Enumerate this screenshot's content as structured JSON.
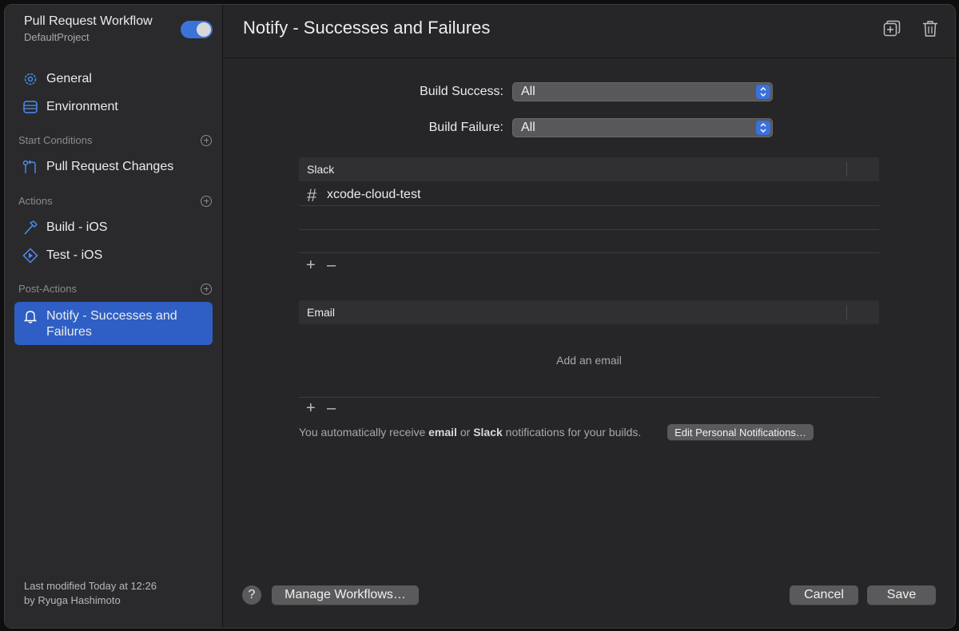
{
  "sidebar": {
    "workflow_title": "Pull Request Workflow",
    "workflow_project": "DefaultProject",
    "toggle_on": true,
    "items": [
      {
        "label": "General",
        "icon": "gear-icon"
      },
      {
        "label": "Environment",
        "icon": "environment-icon"
      }
    ],
    "start_conditions": {
      "heading": "Start Conditions",
      "items": [
        {
          "label": "Pull Request Changes",
          "icon": "pull-request-icon"
        }
      ]
    },
    "actions": {
      "heading": "Actions",
      "items": [
        {
          "label": "Build - iOS",
          "icon": "hammer-icon"
        },
        {
          "label": "Test - iOS",
          "icon": "test-icon"
        }
      ]
    },
    "post_actions": {
      "heading": "Post-Actions",
      "items": [
        {
          "label": "Notify - Successes and Failures",
          "icon": "bell-icon"
        }
      ]
    },
    "last_modified_line1": "Last modified Today at 12:26",
    "last_modified_line2": "by Ryuga Hashimoto"
  },
  "header": {
    "title": "Notify - Successes and Failures"
  },
  "form": {
    "build_success_label": "Build Success:",
    "build_success_value": "All",
    "build_failure_label": "Build Failure:",
    "build_failure_value": "All"
  },
  "slack": {
    "heading": "Slack",
    "channels": [
      "xcode-cloud-test"
    ]
  },
  "email": {
    "heading": "Email",
    "placeholder": "Add an email"
  },
  "note": {
    "prefix": "You automatically receive ",
    "email": "email",
    "or": " or ",
    "slack": "Slack",
    "suffix": " notifications for your builds.",
    "button": "Edit Personal Notifications…"
  },
  "footer": {
    "help": "?",
    "manage": "Manage Workflows…",
    "cancel": "Cancel",
    "save": "Save"
  },
  "colors": {
    "accent": "#2f5fc4",
    "icon_blue": "#4a8cf0"
  }
}
